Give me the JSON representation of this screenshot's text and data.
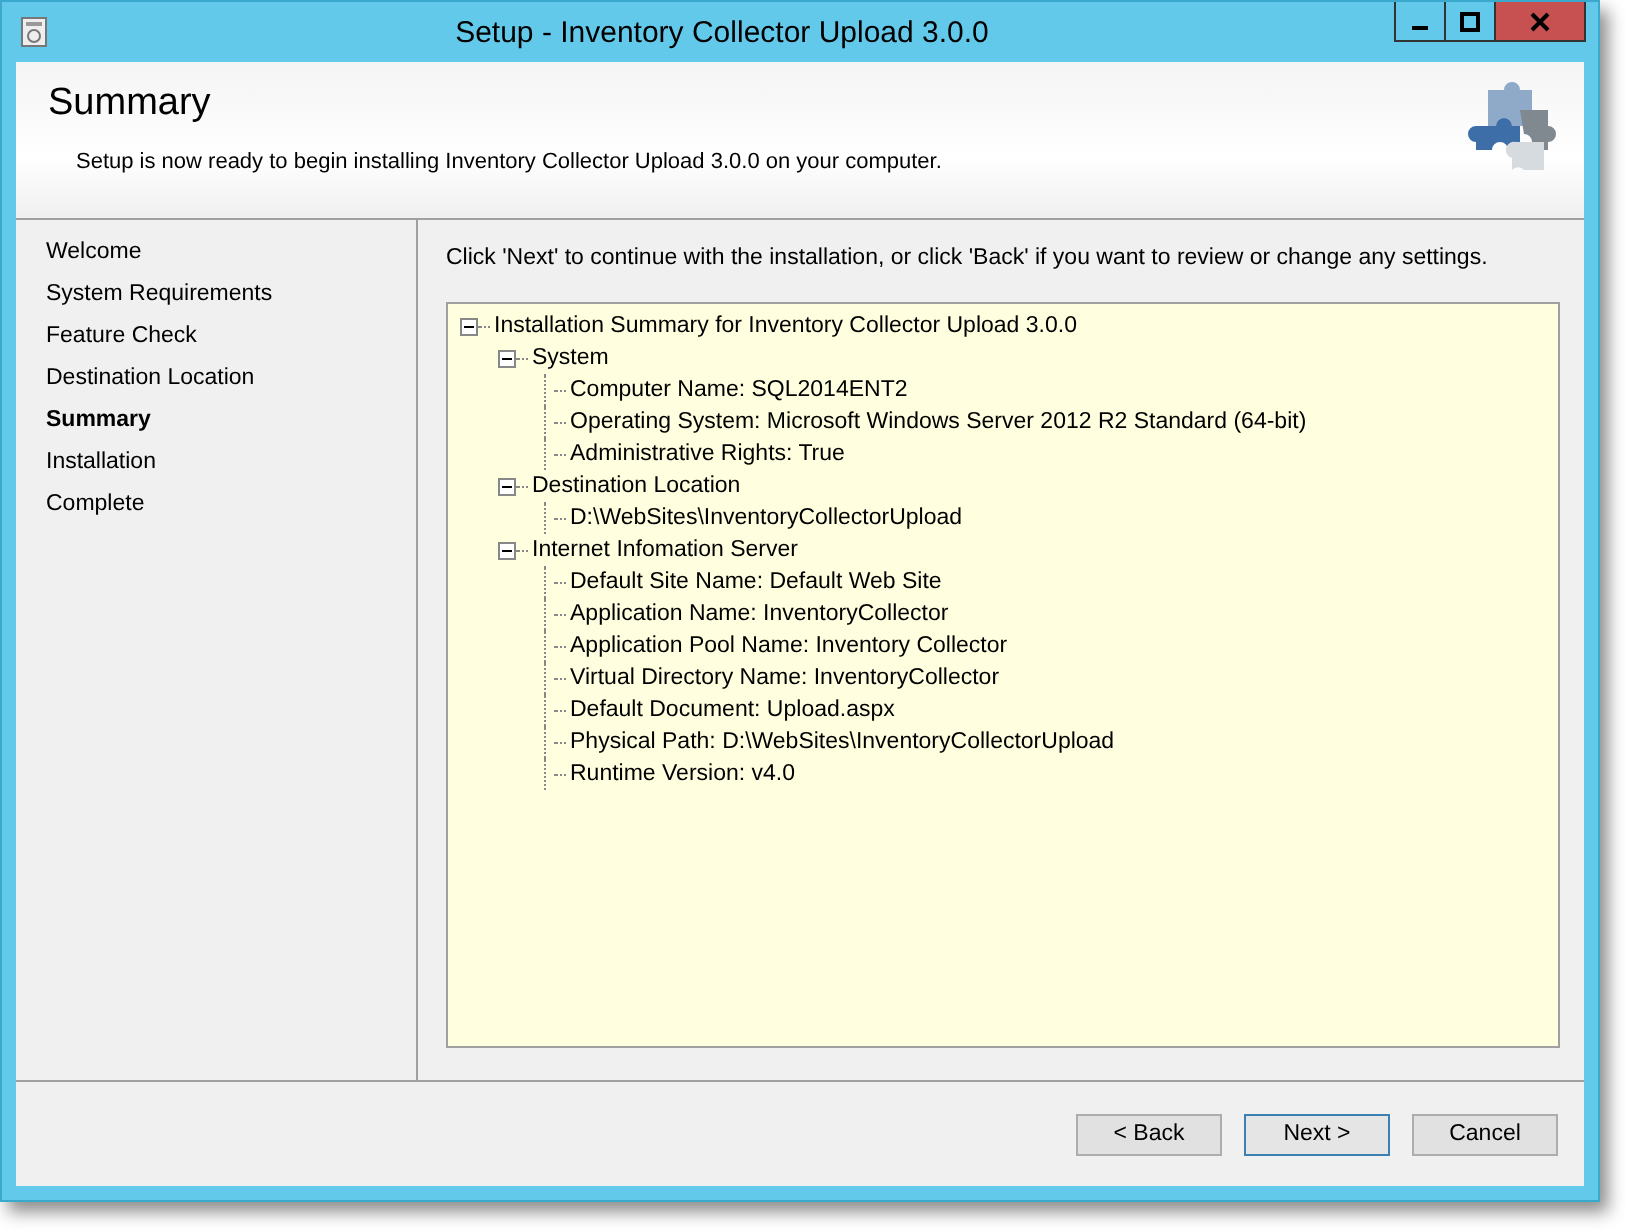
{
  "window": {
    "title": "Setup - Inventory Collector Upload 3.0.0"
  },
  "header": {
    "title": "Summary",
    "subtitle": "Setup is now ready to begin installing Inventory Collector Upload 3.0.0 on your computer."
  },
  "steps": [
    {
      "label": "Welcome",
      "selected": false
    },
    {
      "label": "System Requirements",
      "selected": false
    },
    {
      "label": "Feature Check",
      "selected": false
    },
    {
      "label": "Destination Location",
      "selected": false
    },
    {
      "label": "Summary",
      "selected": true
    },
    {
      "label": "Installation",
      "selected": false
    },
    {
      "label": "Complete",
      "selected": false
    }
  ],
  "instruction": "Click 'Next' to continue with the installation, or click 'Back' if you want to review or change any settings.",
  "tree": [
    {
      "label": "Installation Summary for Inventory Collector Upload 3.0.0",
      "expanded": true,
      "children": [
        {
          "label": "System",
          "expanded": true,
          "children": [
            {
              "label": "Computer Name: SQL2014ENT2"
            },
            {
              "label": "Operating System: Microsoft Windows Server 2012 R2 Standard (64-bit)"
            },
            {
              "label": "Administrative Rights: True"
            }
          ]
        },
        {
          "label": "Destination Location",
          "expanded": true,
          "children": [
            {
              "label": "D:\\WebSites\\InventoryCollectorUpload"
            }
          ]
        },
        {
          "label": "Internet Infomation Server",
          "expanded": true,
          "children": [
            {
              "label": "Default Site Name: Default Web Site"
            },
            {
              "label": "Application Name: InventoryCollector"
            },
            {
              "label": "Application Pool Name: Inventory Collector"
            },
            {
              "label": "Virtual Directory Name: InventoryCollector"
            },
            {
              "label": "Default Document: Upload.aspx"
            },
            {
              "label": "Physical Path: D:\\WebSites\\InventoryCollectorUpload"
            },
            {
              "label": "Runtime Version: v4.0"
            }
          ]
        }
      ]
    }
  ],
  "buttons": [
    {
      "label": "< Back",
      "default": false
    },
    {
      "label": "Next >",
      "default": true
    },
    {
      "label": "Cancel",
      "default": false
    }
  ]
}
